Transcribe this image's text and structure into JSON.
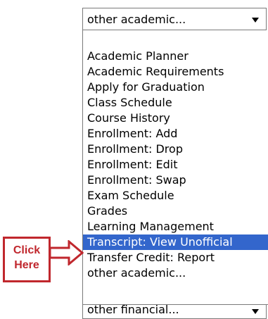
{
  "select": {
    "value": "other academic...",
    "options": [
      "Academic Planner",
      "Academic Requirements",
      "Apply for Graduation",
      "Class Schedule",
      "Course History",
      "Enrollment: Add",
      "Enrollment: Drop",
      "Enrollment: Edit",
      "Enrollment: Swap",
      "Exam Schedule",
      "Grades",
      "Learning Management",
      "Transcript: View Unofficial",
      "Transfer Credit: Report",
      "other academic..."
    ],
    "selected_option": "Transcript: View Unofficial"
  },
  "select_next": {
    "value": "other financial..."
  },
  "callout": {
    "line1": "Click",
    "line2": "Here"
  },
  "colors": {
    "highlight": "#3366cc",
    "callout": "#c0272d"
  },
  "icons": {
    "dropdown_arrow": "chevron-down-icon",
    "pointer": "arrow-right-icon"
  }
}
